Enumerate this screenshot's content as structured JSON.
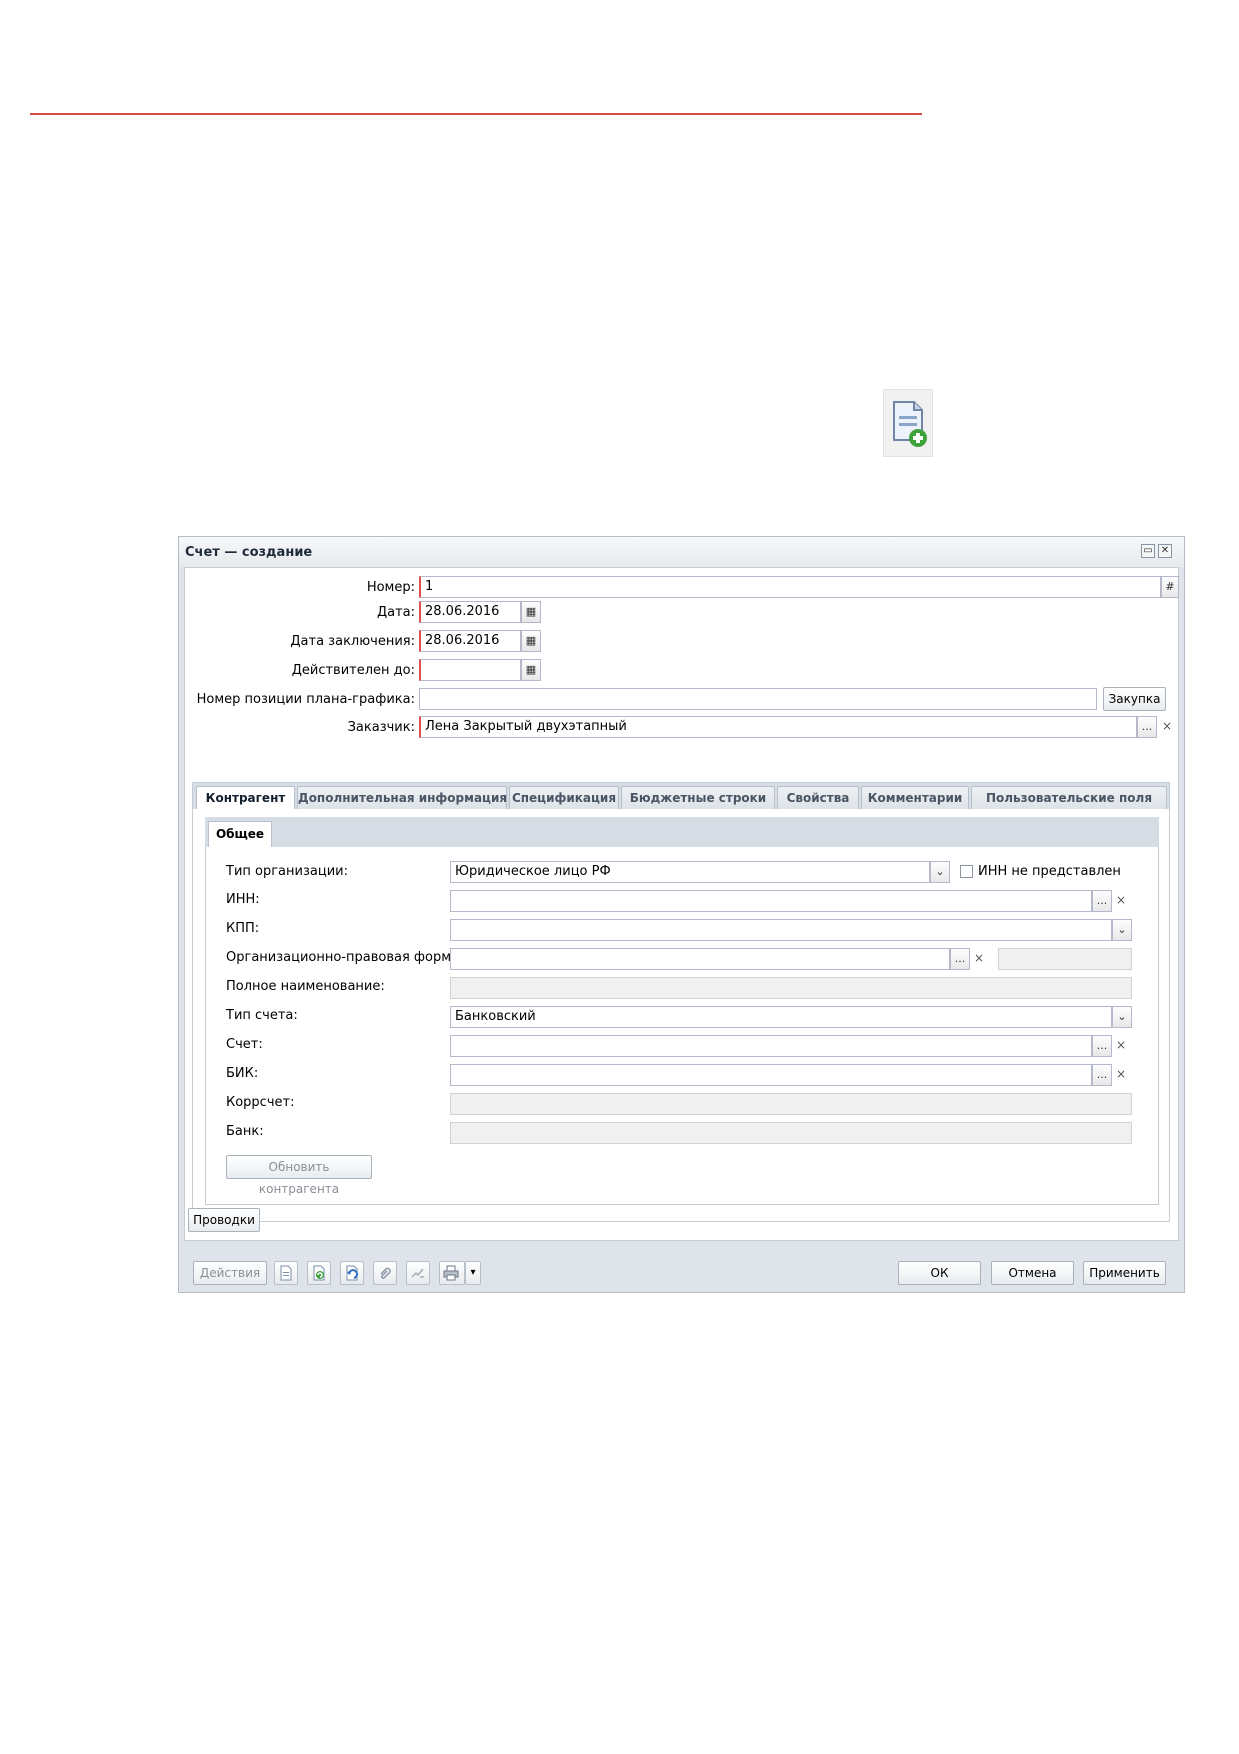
{
  "window": {
    "title": "Счет — создание",
    "maximize_glyph": "▭",
    "close_glyph": "✕"
  },
  "form": {
    "number": {
      "label": "Номер:",
      "value": "1"
    },
    "date": {
      "label": "Дата:",
      "value": "28.06.2016"
    },
    "conclusion_date": {
      "label": "Дата заключения:",
      "value": "28.06.2016"
    },
    "valid_until": {
      "label": "Действителен до:",
      "value": ""
    },
    "plan_position": {
      "label": "Номер позиции плана-графика:",
      "value": "",
      "button": "Закупка"
    },
    "customer": {
      "label": "Заказчик:",
      "value": "Лена Закрытый двухэтапный"
    }
  },
  "tabs": [
    {
      "label": "Контрагент",
      "active": true
    },
    {
      "label": "Дополнительная информация"
    },
    {
      "label": "Спецификация"
    },
    {
      "label": "Бюджетные строки"
    },
    {
      "label": "Свойства"
    },
    {
      "label": "Комментарии"
    },
    {
      "label": "Пользовательские поля"
    }
  ],
  "sub_tab": "Общее",
  "contractor": {
    "org_type": {
      "label": "Тип организации:",
      "value": "Юридическое лицо РФ"
    },
    "inn_missing": {
      "label": "ИНН не представлен",
      "checked": false
    },
    "inn": {
      "label": "ИНН:",
      "value": ""
    },
    "kpp": {
      "label": "КПП:",
      "value": ""
    },
    "legal_form": {
      "label": "Организационно-правовая форма:",
      "value": ""
    },
    "full_name": {
      "label": "Полное наименование:",
      "value": ""
    },
    "account_type": {
      "label": "Тип счета:",
      "value": "Банковский"
    },
    "account": {
      "label": "Счет:",
      "value": ""
    },
    "bik": {
      "label": "БИК:",
      "value": ""
    },
    "corr_account": {
      "label": "Коррсчет:",
      "value": ""
    },
    "bank": {
      "label": "Банк:",
      "value": ""
    },
    "refresh_button": "Обновить контрагента"
  },
  "postings_button": "Проводки",
  "footer": {
    "actions_button": "Действия",
    "ok_button": "ОК",
    "cancel_button": "Отмена",
    "apply_button": "Применить",
    "dropdown_glyph": "▾"
  },
  "glyphs": {
    "ellipsis": "...",
    "clear": "×",
    "chevron": "⌄",
    "hash": "#"
  }
}
